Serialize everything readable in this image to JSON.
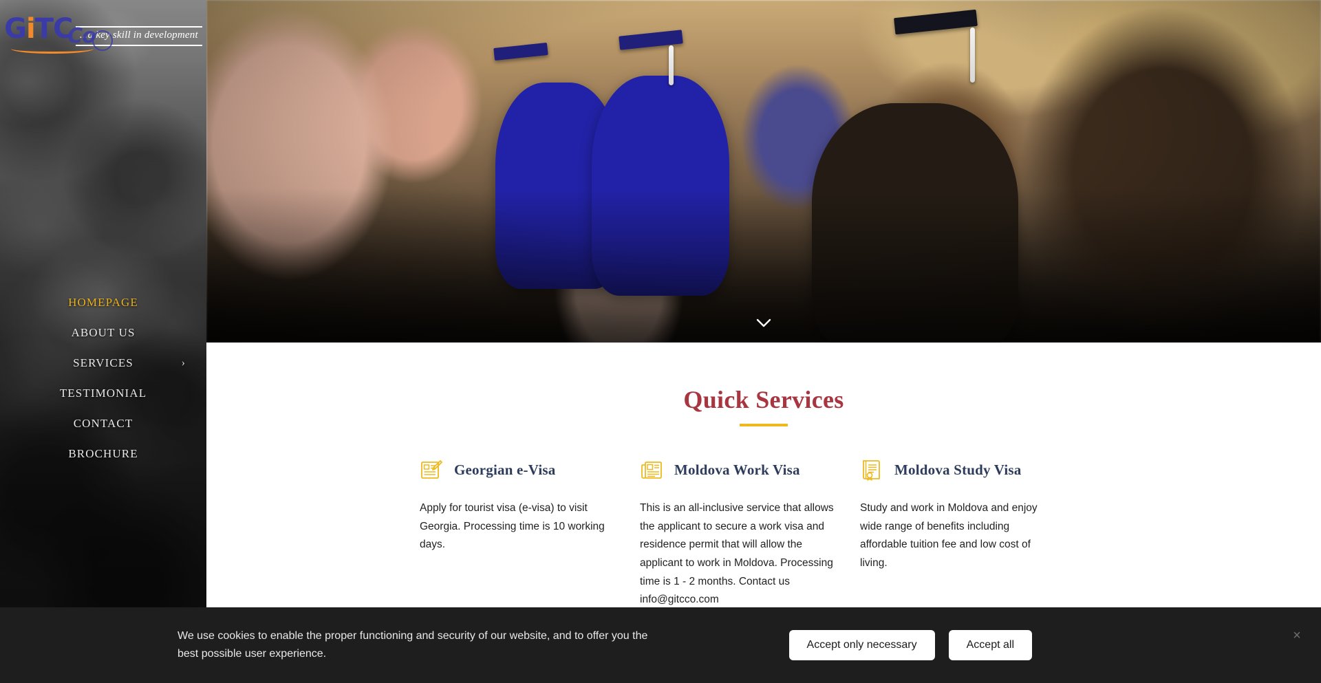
{
  "sidebar": {
    "logo": {
      "text_g": "G",
      "text_i": "i",
      "text_t": "T",
      "text_c": "C",
      "text_co": "Co",
      "tagline": "...a key skill in development"
    },
    "nav": [
      {
        "label": "HOMEPAGE",
        "active": true,
        "has_chevron": false
      },
      {
        "label": "ABOUT US",
        "active": false,
        "has_chevron": false
      },
      {
        "label": "SERVICES",
        "active": false,
        "has_chevron": true,
        "chevron": "›"
      },
      {
        "label": "TESTIMONIAL",
        "active": false,
        "has_chevron": false
      },
      {
        "label": "CONTACT",
        "active": false,
        "has_chevron": false
      },
      {
        "label": "BROCHURE",
        "active": false,
        "has_chevron": false
      }
    ]
  },
  "hero": {
    "scroll_indicator": "chevron-down-icon"
  },
  "main": {
    "section_title": "Quick Services",
    "services": [
      {
        "icon": "document-pen-icon",
        "title": "Georgian e-Visa",
        "body": "Apply for tourist visa (e-visa) to visit Georgia. Processing time is 10 working days."
      },
      {
        "icon": "newspaper-icon",
        "title": "Moldova Work Visa",
        "body": "This is an all-inclusive service that allows the applicant to secure a work visa and residence permit that will allow the applicant to work in Moldova. Processing time is 1 - 2 months. Contact us info@gitcco.com"
      },
      {
        "icon": "certificate-icon",
        "title": "Moldova Study Visa",
        "body": "Study and work in Moldova and enjoy wide range of benefits including affordable tuition fee and low cost of living."
      }
    ]
  },
  "cookie_banner": {
    "message": "We use cookies to enable the proper functioning and security of our website, and to offer you the best possible user experience.",
    "accept_necessary_label": "Accept only necessary",
    "accept_all_label": "Accept all",
    "close_label": "×"
  },
  "colors": {
    "brand_blue": "#3b3ba8",
    "brand_orange": "#f08a2a",
    "accent_gold": "#edb91f",
    "heading_red": "#a83641",
    "service_title_navy": "#2e3c5c",
    "nav_active": "#e8b119",
    "banner_bg": "#1e1e1e"
  }
}
